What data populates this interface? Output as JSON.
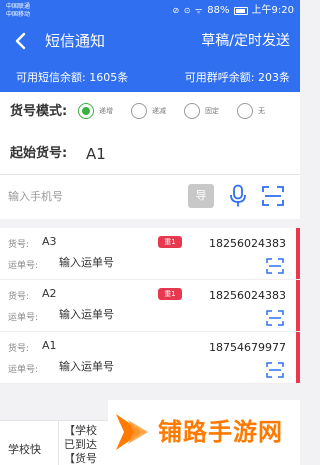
{
  "status_bar": {
    "carrier_1": "中国联通",
    "carrier_2": "中国移动",
    "icons": "⊘ ⊙ ᯤ",
    "battery": "88%",
    "time": "上午9:20"
  },
  "header": {
    "title": "短信通知",
    "action": "草稿/定时发送"
  },
  "balance": {
    "sms": "可用短信余额: 1605条",
    "group_call": "可用群呼余额: 203条"
  },
  "config": {
    "mode_label": "货号模式:",
    "modes": [
      {
        "label": "递增",
        "selected": true
      },
      {
        "label": "递减",
        "selected": false
      },
      {
        "label": "固定",
        "selected": false
      },
      {
        "label": "无",
        "selected": false
      }
    ],
    "start_label": "起始货号:",
    "start_value": "A1",
    "phone_placeholder": "输入手机号",
    "generate_label": "导"
  },
  "rows": [
    {
      "code_key": "货号:",
      "code": "A3",
      "badge": "重1",
      "phone": "18256024383",
      "waybill_key": "运单号:",
      "waybill_placeholder": "输入运单号",
      "flag": true
    },
    {
      "code_key": "货号:",
      "code": "A2",
      "badge": "重1",
      "phone": "18256024383",
      "waybill_key": "运单号:",
      "waybill_placeholder": "输入运单号",
      "flag": true
    },
    {
      "code_key": "货号:",
      "code": "A1",
      "badge": "",
      "phone": "18754679977",
      "waybill_key": "运单号:",
      "waybill_placeholder": "输入运单号",
      "flag": true
    }
  ],
  "bottom": {
    "label": "学校快",
    "lines": [
      "【学校",
      "已到达",
      "【货号"
    ]
  },
  "watermark": {
    "text": "铺路手游网"
  },
  "colors": {
    "primary": "#2f6ff0",
    "radio_selected": "#3cb043",
    "badge": "#e8384f",
    "watermark": "#ff7a00"
  }
}
